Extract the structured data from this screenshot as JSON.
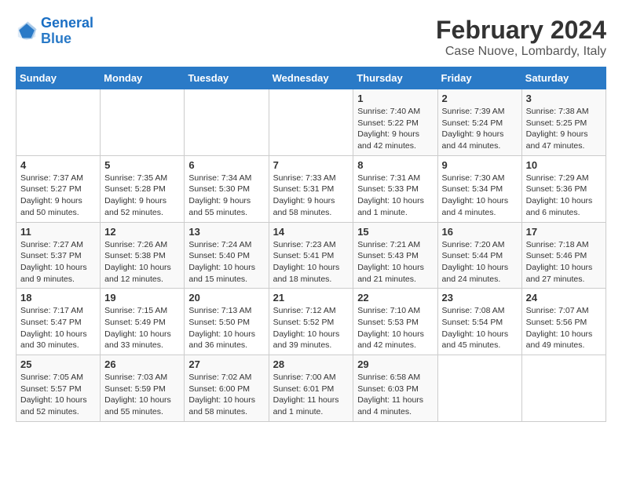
{
  "logo": {
    "line1": "General",
    "line2": "Blue"
  },
  "title": "February 2024",
  "subtitle": "Case Nuove, Lombardy, Italy",
  "headers": [
    "Sunday",
    "Monday",
    "Tuesday",
    "Wednesday",
    "Thursday",
    "Friday",
    "Saturday"
  ],
  "rows": [
    [
      {
        "day": "",
        "info": ""
      },
      {
        "day": "",
        "info": ""
      },
      {
        "day": "",
        "info": ""
      },
      {
        "day": "",
        "info": ""
      },
      {
        "day": "1",
        "info": "Sunrise: 7:40 AM\nSunset: 5:22 PM\nDaylight: 9 hours and 42 minutes."
      },
      {
        "day": "2",
        "info": "Sunrise: 7:39 AM\nSunset: 5:24 PM\nDaylight: 9 hours and 44 minutes."
      },
      {
        "day": "3",
        "info": "Sunrise: 7:38 AM\nSunset: 5:25 PM\nDaylight: 9 hours and 47 minutes."
      }
    ],
    [
      {
        "day": "4",
        "info": "Sunrise: 7:37 AM\nSunset: 5:27 PM\nDaylight: 9 hours and 50 minutes."
      },
      {
        "day": "5",
        "info": "Sunrise: 7:35 AM\nSunset: 5:28 PM\nDaylight: 9 hours and 52 minutes."
      },
      {
        "day": "6",
        "info": "Sunrise: 7:34 AM\nSunset: 5:30 PM\nDaylight: 9 hours and 55 minutes."
      },
      {
        "day": "7",
        "info": "Sunrise: 7:33 AM\nSunset: 5:31 PM\nDaylight: 9 hours and 58 minutes."
      },
      {
        "day": "8",
        "info": "Sunrise: 7:31 AM\nSunset: 5:33 PM\nDaylight: 10 hours and 1 minute."
      },
      {
        "day": "9",
        "info": "Sunrise: 7:30 AM\nSunset: 5:34 PM\nDaylight: 10 hours and 4 minutes."
      },
      {
        "day": "10",
        "info": "Sunrise: 7:29 AM\nSunset: 5:36 PM\nDaylight: 10 hours and 6 minutes."
      }
    ],
    [
      {
        "day": "11",
        "info": "Sunrise: 7:27 AM\nSunset: 5:37 PM\nDaylight: 10 hours and 9 minutes."
      },
      {
        "day": "12",
        "info": "Sunrise: 7:26 AM\nSunset: 5:38 PM\nDaylight: 10 hours and 12 minutes."
      },
      {
        "day": "13",
        "info": "Sunrise: 7:24 AM\nSunset: 5:40 PM\nDaylight: 10 hours and 15 minutes."
      },
      {
        "day": "14",
        "info": "Sunrise: 7:23 AM\nSunset: 5:41 PM\nDaylight: 10 hours and 18 minutes."
      },
      {
        "day": "15",
        "info": "Sunrise: 7:21 AM\nSunset: 5:43 PM\nDaylight: 10 hours and 21 minutes."
      },
      {
        "day": "16",
        "info": "Sunrise: 7:20 AM\nSunset: 5:44 PM\nDaylight: 10 hours and 24 minutes."
      },
      {
        "day": "17",
        "info": "Sunrise: 7:18 AM\nSunset: 5:46 PM\nDaylight: 10 hours and 27 minutes."
      }
    ],
    [
      {
        "day": "18",
        "info": "Sunrise: 7:17 AM\nSunset: 5:47 PM\nDaylight: 10 hours and 30 minutes."
      },
      {
        "day": "19",
        "info": "Sunrise: 7:15 AM\nSunset: 5:49 PM\nDaylight: 10 hours and 33 minutes."
      },
      {
        "day": "20",
        "info": "Sunrise: 7:13 AM\nSunset: 5:50 PM\nDaylight: 10 hours and 36 minutes."
      },
      {
        "day": "21",
        "info": "Sunrise: 7:12 AM\nSunset: 5:52 PM\nDaylight: 10 hours and 39 minutes."
      },
      {
        "day": "22",
        "info": "Sunrise: 7:10 AM\nSunset: 5:53 PM\nDaylight: 10 hours and 42 minutes."
      },
      {
        "day": "23",
        "info": "Sunrise: 7:08 AM\nSunset: 5:54 PM\nDaylight: 10 hours and 45 minutes."
      },
      {
        "day": "24",
        "info": "Sunrise: 7:07 AM\nSunset: 5:56 PM\nDaylight: 10 hours and 49 minutes."
      }
    ],
    [
      {
        "day": "25",
        "info": "Sunrise: 7:05 AM\nSunset: 5:57 PM\nDaylight: 10 hours and 52 minutes."
      },
      {
        "day": "26",
        "info": "Sunrise: 7:03 AM\nSunset: 5:59 PM\nDaylight: 10 hours and 55 minutes."
      },
      {
        "day": "27",
        "info": "Sunrise: 7:02 AM\nSunset: 6:00 PM\nDaylight: 10 hours and 58 minutes."
      },
      {
        "day": "28",
        "info": "Sunrise: 7:00 AM\nSunset: 6:01 PM\nDaylight: 11 hours and 1 minute."
      },
      {
        "day": "29",
        "info": "Sunrise: 6:58 AM\nSunset: 6:03 PM\nDaylight: 11 hours and 4 minutes."
      },
      {
        "day": "",
        "info": ""
      },
      {
        "day": "",
        "info": ""
      }
    ]
  ]
}
